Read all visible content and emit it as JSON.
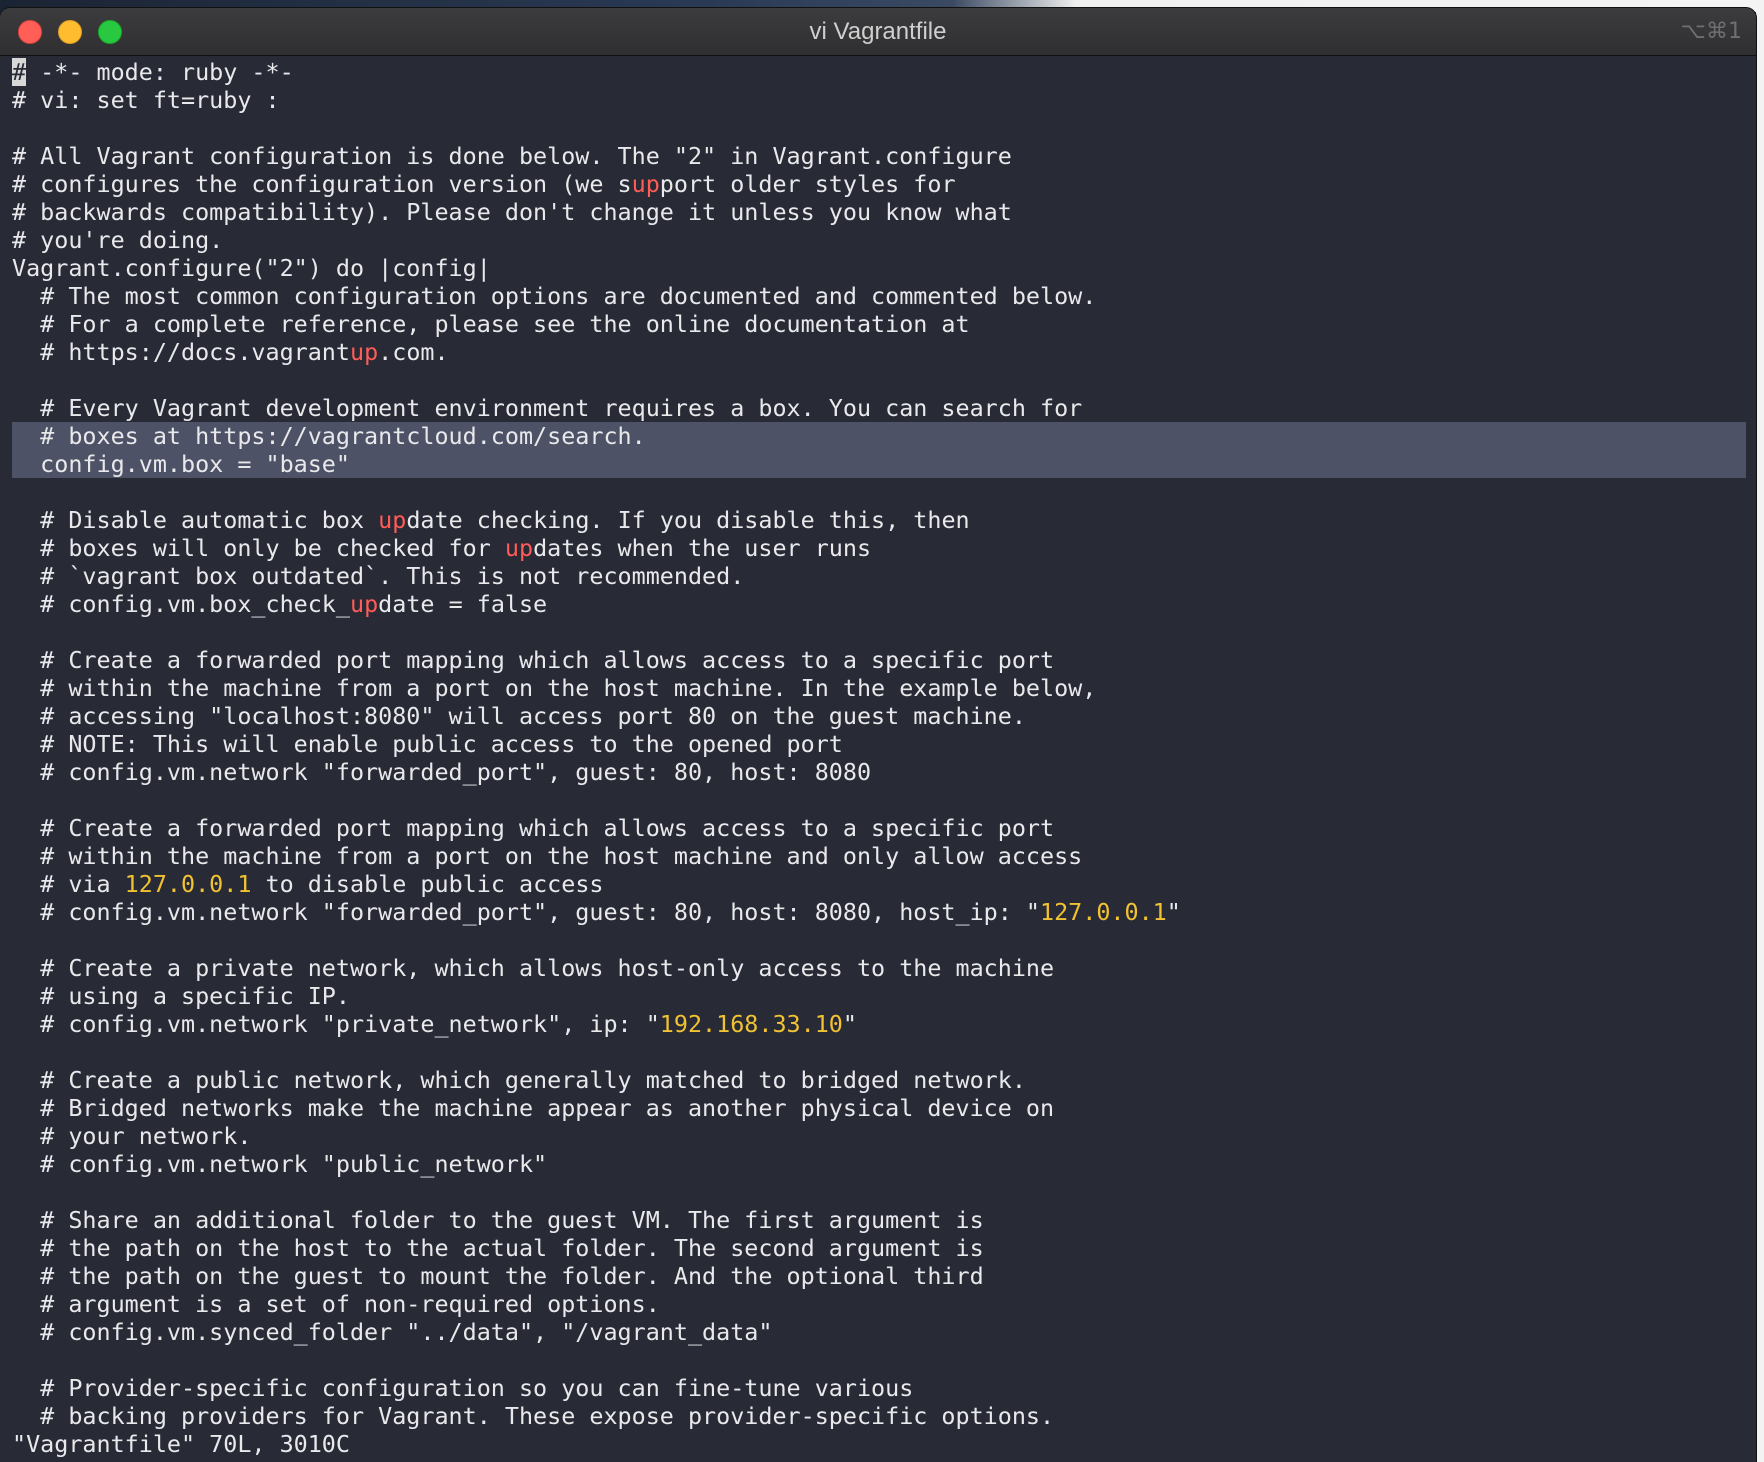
{
  "window": {
    "title": "vi Vagrantfile",
    "shortcut": "⌥⌘1",
    "buttons": {
      "close": "×",
      "minimize": "−",
      "zoom": "+"
    }
  },
  "editor": {
    "cursor_char": "#",
    "lines": {
      "l1": " -*- mode: ruby -*-",
      "l2": "# vi: set ft=ruby :",
      "l3": "",
      "l4": "# All Vagrant configuration is done below. The \"2\" in Vagrant.configure",
      "l5a": "# configures the configuration version (we s",
      "l5b": "up",
      "l5c": "port older styles for",
      "l6": "# backwards compatibility). Please don't change it unless you know what",
      "l7": "# you're doing.",
      "l8": "Vagrant.configure(\"2\") do |config|",
      "l9": "  # The most common configuration options are documented and commented below.",
      "l10": "  # For a complete reference, please see the online documentation at",
      "l11a": "  # https://docs.vagrant",
      "l11b": "up",
      "l11c": ".com.",
      "l12": "",
      "l13": "  # Every Vagrant development environment requires a box. You can search for",
      "l14": "  # boxes at https://vagrantcloud.com/search.",
      "l15": "  config.vm.box = \"base\"",
      "l16": "",
      "l17a": "  # Disable automatic box ",
      "l17b": "up",
      "l17c": "date checking. If you disable this, then",
      "l18a": "  # boxes will only be checked for ",
      "l18b": "up",
      "l18c": "dates when the user runs",
      "l19": "  # `vagrant box outdated`. This is not recommended.",
      "l20a": "  # config.vm.box_check_",
      "l20b": "up",
      "l20c": "date = false",
      "l21": "",
      "l22": "  # Create a forwarded port mapping which allows access to a specific port",
      "l23": "  # within the machine from a port on the host machine. In the example below,",
      "l24": "  # accessing \"localhost:8080\" will access port 80 on the guest machine.",
      "l25": "  # NOTE: This will enable public access to the opened port",
      "l26": "  # config.vm.network \"forwarded_port\", guest: 80, host: 8080",
      "l27": "",
      "l28": "  # Create a forwarded port mapping which allows access to a specific port",
      "l29": "  # within the machine from a port on the host machine and only allow access",
      "l30a": "  # via ",
      "l30b": "127.0.0.1",
      "l30c": " to disable public access",
      "l31a": "  # config.vm.network \"forwarded_port\", guest: 80, host: 8080, host_ip: \"",
      "l31b": "127.0.0.1",
      "l31c": "\"",
      "l32": "",
      "l33": "  # Create a private network, which allows host-only access to the machine",
      "l34": "  # using a specific IP.",
      "l35a": "  # config.vm.network \"private_network\", ip: \"",
      "l35b": "192.168.33.10",
      "l35c": "\"",
      "l36": "",
      "l37": "  # Create a public network, which generally matched to bridged network.",
      "l38": "  # Bridged networks make the machine appear as another physical device on",
      "l39": "  # your network.",
      "l40": "  # config.vm.network \"public_network\"",
      "l41": "",
      "l42": "  # Share an additional folder to the guest VM. The first argument is",
      "l43": "  # the path on the host to the actual folder. The second argument is",
      "l44": "  # the path on the guest to mount the folder. And the optional third",
      "l45": "  # argument is a set of non-required options.",
      "l46": "  # config.vm.synced_folder \"../data\", \"/vagrant_data\"",
      "l47": "",
      "l48": "  # Provider-specific configuration so you can fine-tune various",
      "l49": "  # backing providers for Vagrant. These expose provider-specific options."
    },
    "status_line": "\"Vagrantfile\" 70L, 3010C"
  },
  "colors": {
    "background": "#282a36",
    "foreground": "#e9e9ec",
    "search_highlight": "#ff5c57",
    "string_number": "#f1c232",
    "selection": "#4e5266"
  }
}
